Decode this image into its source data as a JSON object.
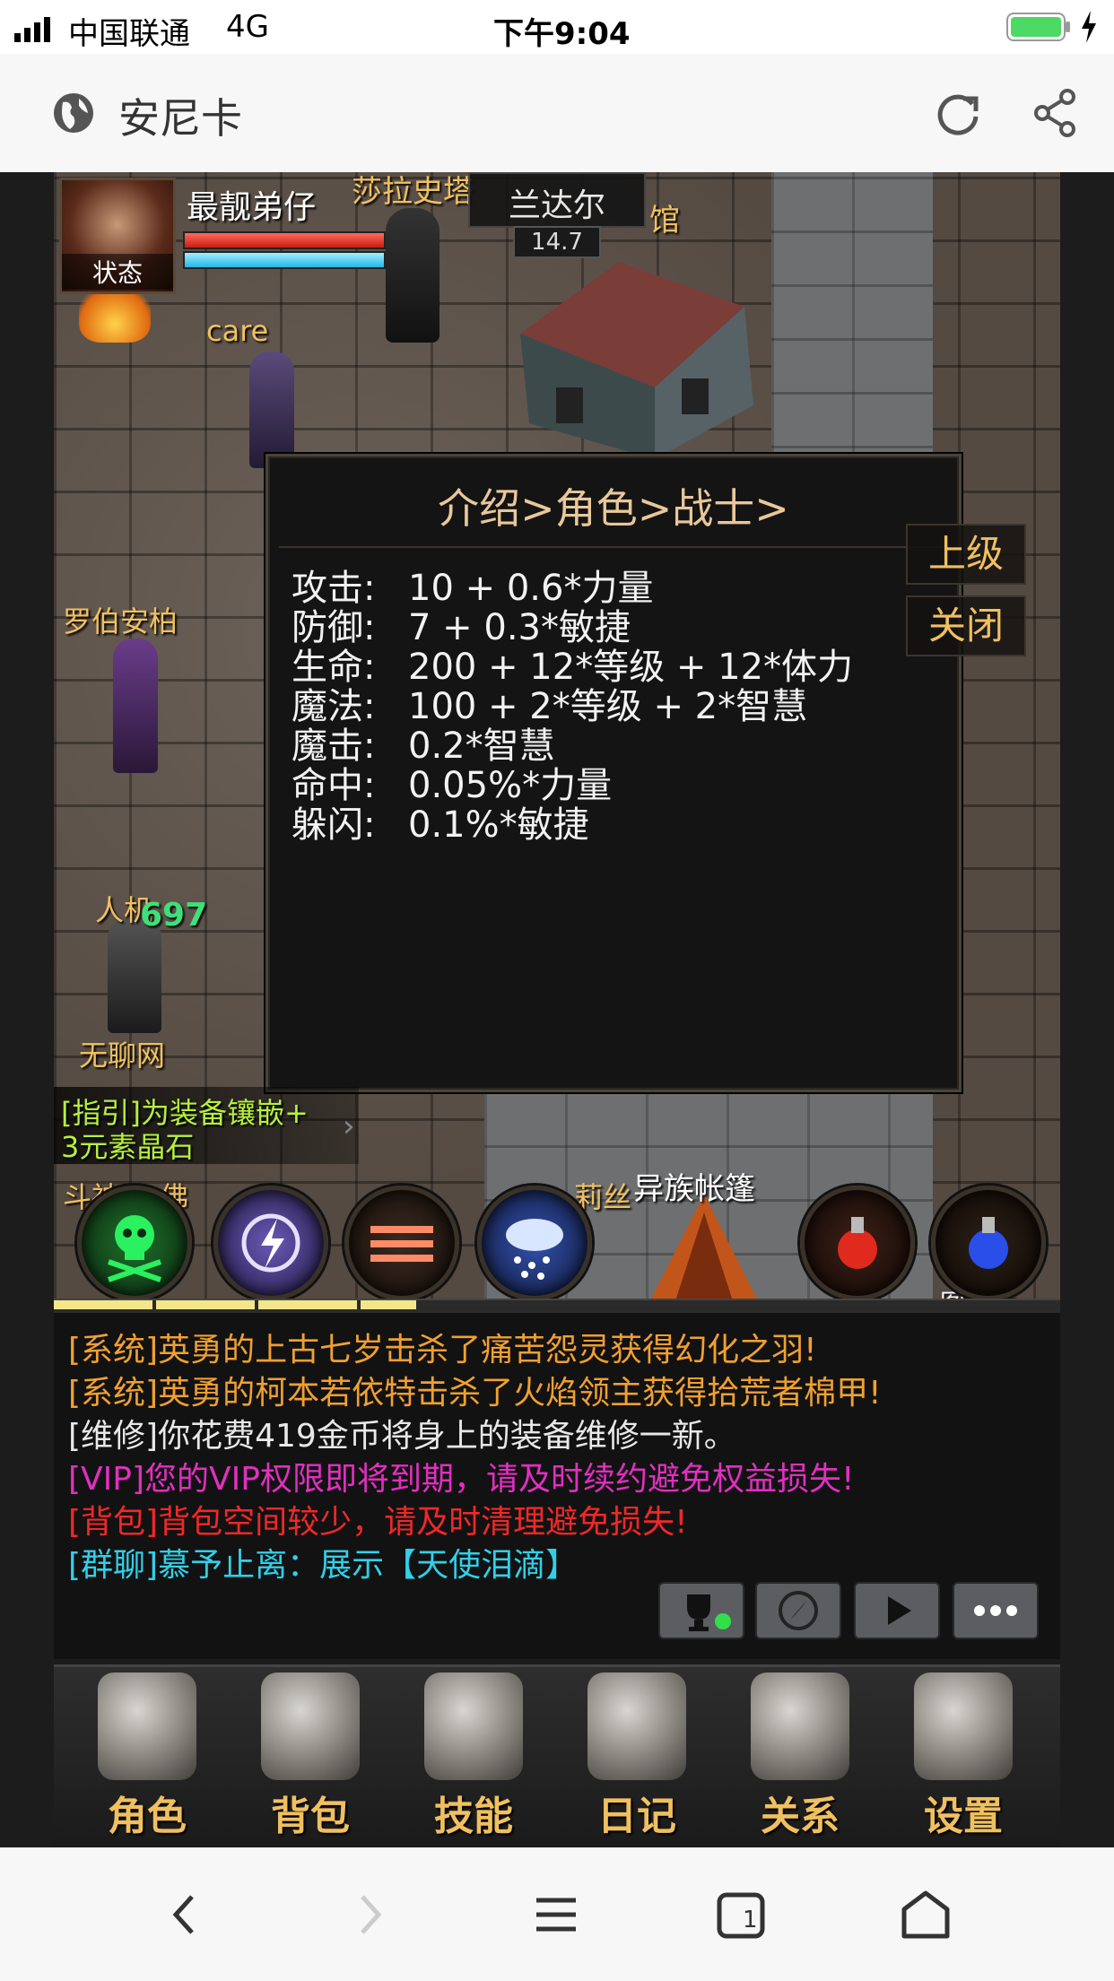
{
  "status_bar": {
    "carrier": "中国联通",
    "network": "4G",
    "time": "下午9:04"
  },
  "browser": {
    "title": "安尼卡",
    "icons": [
      "globe-icon",
      "reload-icon",
      "share-icon"
    ]
  },
  "player": {
    "name": "最靓弟仔",
    "status_label": "状态",
    "hp_fill": 1.0,
    "mp_fill": 1.0
  },
  "map": {
    "name": "兰达尔",
    "coord": "14.7"
  },
  "scene_labels": {
    "npc_top": "莎拉史塔",
    "building_right": "馆",
    "care": "care",
    "robert": "罗伯安柏",
    "renji": "人机",
    "damage": "697",
    "wuliao": "无聊网",
    "doushen": "斗神",
    "buddha": "佛",
    "tent": "异族帐篷",
    "npc_bottom": "莉丝",
    "bottom_right": "图腾柱"
  },
  "dialog": {
    "title": "介绍>角色>战士>",
    "rows": [
      {
        "label": "攻击:",
        "value": "10 + 0.6*力量"
      },
      {
        "label": "防御:",
        "value": "7 + 0.3*敏捷"
      },
      {
        "label": "生命:",
        "value": "200 + 12*等级 + 12*体力"
      },
      {
        "label": "魔法:",
        "value": "100 + 2*等级 + 2*智慧"
      },
      {
        "label": "魔击:",
        "value": "0.2*智慧"
      },
      {
        "label": "命中:",
        "value": "0.05%*力量"
      },
      {
        "label": "躲闪:",
        "value": "0.1%*敏捷"
      }
    ],
    "up_button": "上级",
    "close_button": "关闭"
  },
  "guide": {
    "line1": "[指引]为装备镶嵌+",
    "line2": "3元素晶石"
  },
  "skills": [
    "poison-skull-icon",
    "lightning-icon",
    "triple-slash-icon",
    "storm-cloud-icon"
  ],
  "potions": [
    "red-potion-icon",
    "blue-potion-icon"
  ],
  "chat": {
    "lines": [
      {
        "text": "[系统]英勇的上古七岁击杀了痛苦怨灵获得幻化之羽!",
        "color": "#f0a030"
      },
      {
        "text": "[系统]英勇的柯本若依特击杀了火焰领主获得拾荒者棉甲!",
        "color": "#f0a030"
      },
      {
        "text": "[维修]你花费419金币将身上的装备维修一新。",
        "color": "#e8e8e8"
      },
      {
        "text": "[VIP]您的VIP权限即将到期，请及时续约避免权益损失!",
        "color": "#e030c0"
      },
      {
        "text": "[背包]背包空间较少，请及时清理避免损失!",
        "color": "#f02828"
      },
      {
        "text": "[群聊]慕予止离：展示【天使泪滴】",
        "color": "#30d0e8"
      }
    ],
    "buttons": [
      "trophy-icon",
      "compass-icon",
      "play-icon",
      "chat-bubble-icon"
    ]
  },
  "menu": [
    {
      "label": "角色",
      "icon": "helmet-icon"
    },
    {
      "label": "背包",
      "icon": "backpack-icon"
    },
    {
      "label": "技能",
      "icon": "skillbook-icon"
    },
    {
      "label": "日记",
      "icon": "scroll-icon"
    },
    {
      "label": "关系",
      "icon": "handshake-icon"
    },
    {
      "label": "设置",
      "icon": "gear-icon"
    }
  ],
  "navbar": [
    "back-icon",
    "forward-icon",
    "menu-icon",
    "tabs-icon",
    "home-icon"
  ]
}
